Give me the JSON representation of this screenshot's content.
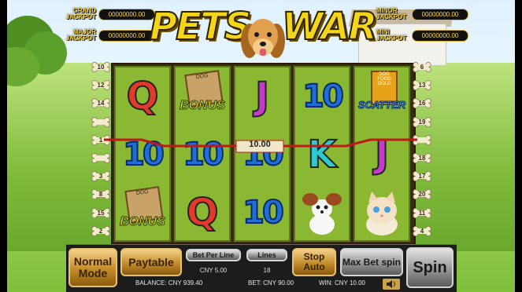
{
  "jackpots": {
    "grand": {
      "label_l1": "GRAND",
      "label_l2": "JACKPOT",
      "value": "00000000.00"
    },
    "major": {
      "label_l1": "MAJOR",
      "label_l2": "JACKPOT",
      "value": "00000000.00"
    },
    "minor": {
      "label_l1": "MINOR",
      "label_l2": "JACKPOT",
      "value": "00000000.00"
    },
    "mini": {
      "label_l1": "MINI",
      "label_l2": "JACKPOT",
      "value": "00000000.00"
    }
  },
  "title": {
    "word1": "PETS",
    "word2": "WAR"
  },
  "left_lines": [
    "10",
    "12",
    "14",
    "",
    "1",
    "",
    "3",
    "8",
    "15",
    "2"
  ],
  "right_lines": [
    "6",
    "13",
    "16",
    "19",
    "",
    "18",
    "17",
    "20",
    "11",
    "4"
  ],
  "reels": [
    [
      {
        "type": "letter",
        "text": "Q",
        "color": "#e23a2a"
      },
      {
        "type": "ten",
        "text": "10"
      },
      {
        "type": "bonus",
        "text": "BONUS",
        "sign": "DOG"
      }
    ],
    [
      {
        "type": "bonus",
        "text": "BONUS",
        "sign": "DOG"
      },
      {
        "type": "ten",
        "text": "10"
      },
      {
        "type": "letter",
        "text": "Q",
        "color": "#e23a2a"
      }
    ],
    [
      {
        "type": "letter",
        "text": "J",
        "color": "#c23cc8"
      },
      {
        "type": "ten",
        "text": "10"
      },
      {
        "type": "ten",
        "text": "10"
      }
    ],
    [
      {
        "type": "ten",
        "text": "10"
      },
      {
        "type": "letter",
        "text": "K",
        "color": "#2fcad0"
      },
      {
        "type": "pet",
        "text": "papillon-dog"
      }
    ],
    [
      {
        "type": "scatter",
        "text": "SCATTER",
        "sign": "DOG FOOD GOLD"
      },
      {
        "type": "letter",
        "text": "J",
        "color": "#c23cc8"
      },
      {
        "type": "pet",
        "text": "kitten"
      }
    ]
  ],
  "win_line_amount": "10.00",
  "controls": {
    "normal_mode": "Normal Mode",
    "paytable": "Paytable",
    "bet_per_line_label": "Bet Per Line",
    "bet_per_line_value": "CNY 5.00",
    "lines_label": "Lines",
    "lines_value": "18",
    "stop_auto": "Stop Auto",
    "max_bet": "Max Bet spin",
    "spin": "Spin"
  },
  "status": {
    "balance": "BALANCE: CNY 939.40",
    "bet": "BET: CNY 90.00",
    "win": "WIN: CNY 10.00"
  },
  "icons": {
    "sound": "speaker-icon"
  },
  "colors": {
    "gold": "#f5d51a",
    "reel_bg": "#8ab833",
    "win_line": "#c01818"
  }
}
